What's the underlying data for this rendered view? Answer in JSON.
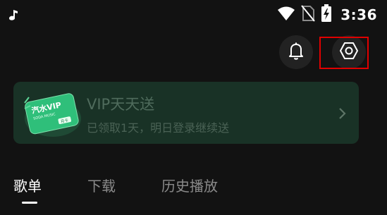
{
  "status_bar": {
    "time": "3:36",
    "left_icon": "music-note-icon",
    "icons": [
      "wifi-icon",
      "no-sim-icon",
      "battery-charging-icon"
    ]
  },
  "header": {
    "bell_icon": "bell-icon",
    "settings_icon": "settings-hexagon-icon",
    "highlight_color": "#e00000"
  },
  "vip_banner": {
    "card_logo_text": "汽水VIP",
    "card_sub_text": "SODA MUSIC",
    "card_badge": "月卡",
    "title": "VIP天天送",
    "subtitle": "已领取1天，明日登录继续送",
    "background": "#193226",
    "accent": "#2fbf7a"
  },
  "tabs": [
    {
      "label": "歌单",
      "active": true
    },
    {
      "label": "下载",
      "active": false
    },
    {
      "label": "历史播放",
      "active": false
    }
  ]
}
